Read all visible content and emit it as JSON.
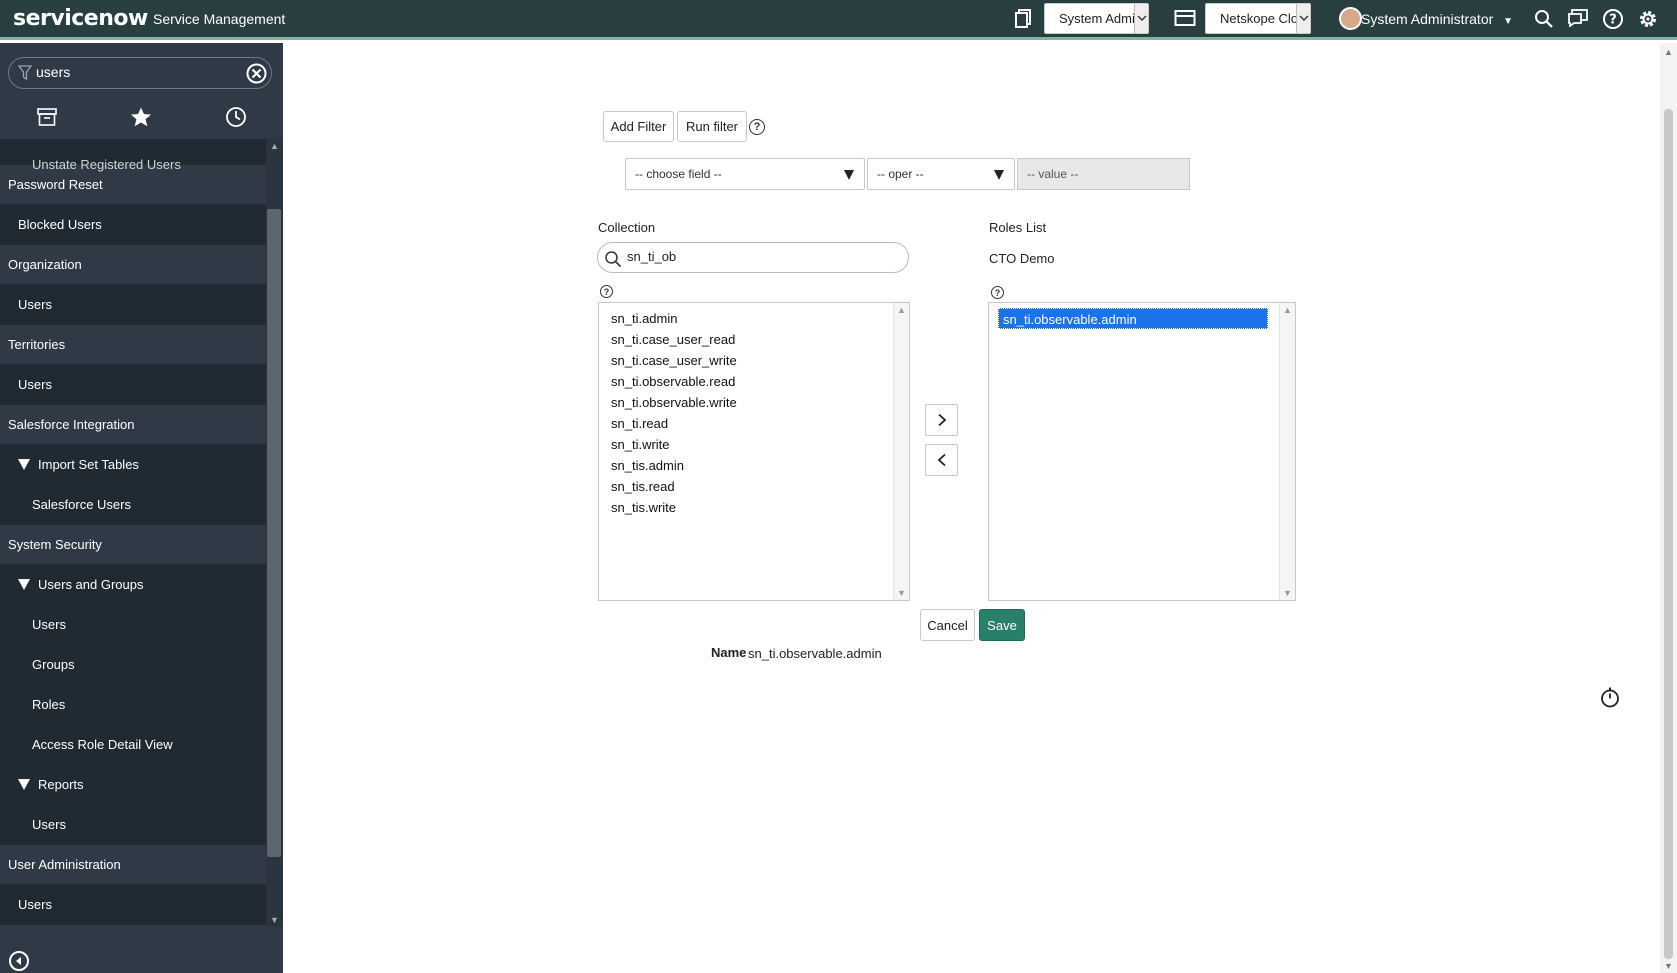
{
  "header": {
    "logo": "servicenow",
    "app_title": "Service Management",
    "scope_select": "System Admi",
    "instance_select": "Netskope Clo",
    "user_name": "System Administrator",
    "colors": {
      "bar": "#293e40",
      "accent": "#81b5a1"
    }
  },
  "sidebar": {
    "filter_value": "users",
    "partial_item": "Unstate Registered Users",
    "items": [
      {
        "label": "Password Reset",
        "level": "section"
      },
      {
        "label": "Blocked Users",
        "level": "l1"
      },
      {
        "label": "Organization",
        "level": "section"
      },
      {
        "label": "Users",
        "level": "l1"
      },
      {
        "label": "Territories",
        "level": "section"
      },
      {
        "label": "Users",
        "level": "l1"
      },
      {
        "label": "Salesforce Integration",
        "level": "section"
      },
      {
        "label": "Import Set Tables",
        "level": "group"
      },
      {
        "label": "Salesforce Users",
        "level": "l2"
      },
      {
        "label": "System Security",
        "level": "section"
      },
      {
        "label": "Users and Groups",
        "level": "group"
      },
      {
        "label": "Users",
        "level": "l2"
      },
      {
        "label": "Groups",
        "level": "l2"
      },
      {
        "label": "Roles",
        "level": "l2"
      },
      {
        "label": "Access Role Detail View",
        "level": "l2"
      },
      {
        "label": "Reports",
        "level": "group"
      },
      {
        "label": "Users",
        "level": "l2"
      },
      {
        "label": "User Administration",
        "level": "section"
      },
      {
        "label": "Users",
        "level": "l1"
      }
    ]
  },
  "filter": {
    "add_filter": "Add Filter",
    "run_filter": "Run filter",
    "choose_field": "-- choose field --",
    "oper": "-- oper --",
    "value": "-- value --"
  },
  "collection": {
    "label": "Collection",
    "search_value": "sn_ti_ob",
    "options": [
      "sn_ti.admin",
      "sn_ti.case_user_read",
      "sn_ti.case_user_write",
      "sn_ti.observable.read",
      "sn_ti.observable.write",
      "sn_ti.read",
      "sn_ti.write",
      "sn_tis.admin",
      "sn_tis.read",
      "sn_tis.write"
    ]
  },
  "roles_list": {
    "label": "Roles List",
    "subtitle": "CTO Demo",
    "options": [
      "sn_ti.observable.admin"
    ]
  },
  "actions": {
    "cancel": "Cancel",
    "save": "Save",
    "save_color": "#278069"
  },
  "name_field": {
    "label": "Name",
    "value": "sn_ti.observable.admin"
  }
}
